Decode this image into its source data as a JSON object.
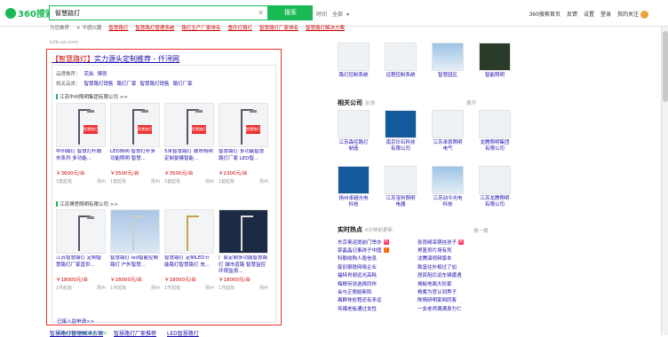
{
  "header": {
    "logo": "360搜索",
    "query": "智慧路灯",
    "search_button": "搜索",
    "time_label": "时间",
    "time_value": "全部",
    "links": [
      "360搜索首页",
      "反馈",
      "设置",
      "登录"
    ],
    "user": "我的关注"
  },
  "related": {
    "label": "为您推荐",
    "sep": "|",
    "close": "不感兴趣",
    "items": [
      "智慧路灯",
      "智慧路灯管理系统",
      "路灯生产厂家排名",
      "重庆灯路灯",
      "智慧路灯厂家排名",
      "智慧路灯解决方案"
    ]
  },
  "src_line": "b2b.so.com",
  "ad": {
    "title_hl": "【智慧路灯】",
    "title_rest": "实力源头定制推荐 - 仟浔网",
    "brand_label": "品牌推荐：",
    "brands": [
      "花灿",
      "博邑"
    ],
    "related_label": "相关品类：",
    "cats": [
      "智慧路灯销售",
      "路灯厂家",
      "智慧路灯销售",
      "路灯厂家"
    ],
    "shop1": "江苏中州照明集团有限公司 >>",
    "shop2": "江苏博思照明有限公司 >>",
    "products1": [
      {
        "title": "中州路灯 智慧灯杆城市系列 多功能...",
        "price": "￥3600元/台",
        "meta": "1套起批",
        "loc": "扬州"
      },
      {
        "title": "LED照明 智慧灯杆多功能照明 智慧...",
        "price": "￥3500元/台",
        "meta": "1套起批",
        "loc": "扬州"
      },
      {
        "title": "5米智慧路灯 城市照明 定制复模智能...",
        "price": "￥3500元/台",
        "meta": "1套起批",
        "loc": "扬州"
      },
      {
        "title": "智慧路灯 多功能智慧路灯厂家 LED智...",
        "price": "￥2300元/台",
        "meta": "1套起批",
        "loc": "扬州"
      }
    ],
    "products2": [
      {
        "title": "江苏智慧路灯 定制智慧路灯厂家直供...",
        "price": "￥18000元/台",
        "meta": "1件起批",
        "loc": "扬州"
      },
      {
        "title": "智慧路灯 led智能控制路灯 户外智慧...",
        "price": "￥18000元/台",
        "meta": "1件起批",
        "loc": "扬州"
      },
      {
        "title": "智慧路灯 定制LED节能路灯智慧路灯 充...",
        "price": "￥18000元/台",
        "meta": "1件起批",
        "loc": "扬州"
      },
      {
        "title": "厂家定制多功能智慧路灯 城市道路 智慧监控环境监测...",
        "price": "￥18000元/台",
        "meta": "1件起批",
        "loc": "扬州"
      }
    ],
    "more": "已接入驻申请>>",
    "url": "www.qianyuwang.com"
  },
  "bottom": [
    "智慧路灯管理解决方案",
    "智慧路灯厂家推荐",
    "LED智慧路灯"
  ],
  "right": {
    "top_items": [
      "路灯控制系统",
      "远程控制系统",
      "智慧园区",
      "智能照明"
    ],
    "company_head": "相关公司",
    "company_sub": "反馈",
    "expand": "展开",
    "companies_row1": [
      "江苏森控路灯制造",
      "南京珍石科技有限公司",
      "江苏承恩照明电气",
      "龙腾照明集团有限公司"
    ],
    "companies_row2": [
      "扬州卓越光电科技",
      "江苏宝利照明电器",
      "江苏动今光电科技",
      "江苏龙腾照明有限公司"
    ],
    "hot_head": "实时热点",
    "hot_sub": "6分钟前更新",
    "hot_more": "换一换",
    "hot": [
      [
        "东京奥运提前门举办",
        "张雨绮呆萌挂孩子"
      ],
      [
        "郭晶晶记事孩子中国",
        "男篮员片场有死"
      ],
      [
        "科勒收购人脸信息",
        "沈腾演视频版本"
      ],
      [
        "废旧钢铁网络企业",
        "致富往外相过了加"
      ],
      [
        "福特肖胡远光高耗",
        "居民阻拦运车辆遭遇"
      ],
      [
        "梅根何说选择同伴",
        "揭秘地面大形家"
      ],
      [
        "会与正佩始新阳",
        "杨紫为官认到秀子"
      ],
      [
        "离群休处程还有多远",
        "陈情研明家网同客"
      ],
      [
        "传媒老板通过女性",
        "一女老师满满身为仁"
      ]
    ]
  }
}
